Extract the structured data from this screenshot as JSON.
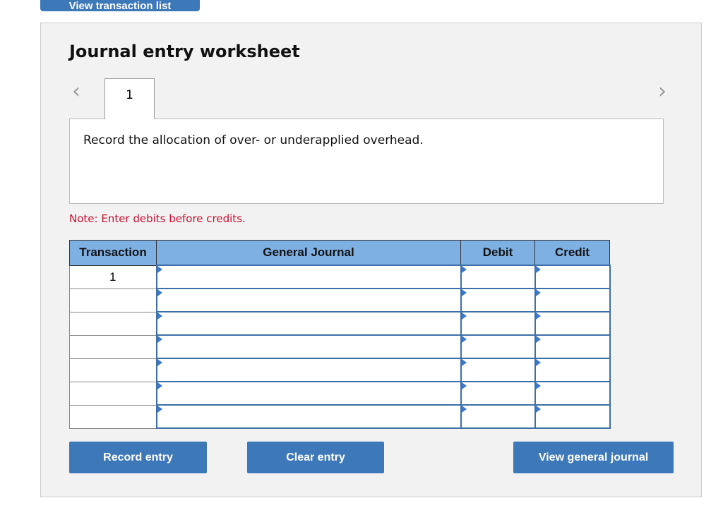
{
  "top_button": "View transaction list",
  "title": "Journal entry worksheet",
  "tabs": [
    {
      "label": "1"
    }
  ],
  "description": "Record the allocation of over- or underapplied overhead.",
  "note": "Note: Enter debits before credits.",
  "table": {
    "headers": [
      "Transaction",
      "General Journal",
      "Debit",
      "Credit"
    ],
    "rows": [
      {
        "transaction": "1"
      },
      {
        "transaction": ""
      },
      {
        "transaction": ""
      },
      {
        "transaction": ""
      },
      {
        "transaction": ""
      },
      {
        "transaction": ""
      },
      {
        "transaction": ""
      }
    ]
  },
  "buttons": {
    "record": "Record entry",
    "clear": "Clear entry",
    "view": "View general journal"
  },
  "colors": {
    "accent": "#3d78b9",
    "header": "#7eb0e3",
    "note": "#c8102e"
  }
}
